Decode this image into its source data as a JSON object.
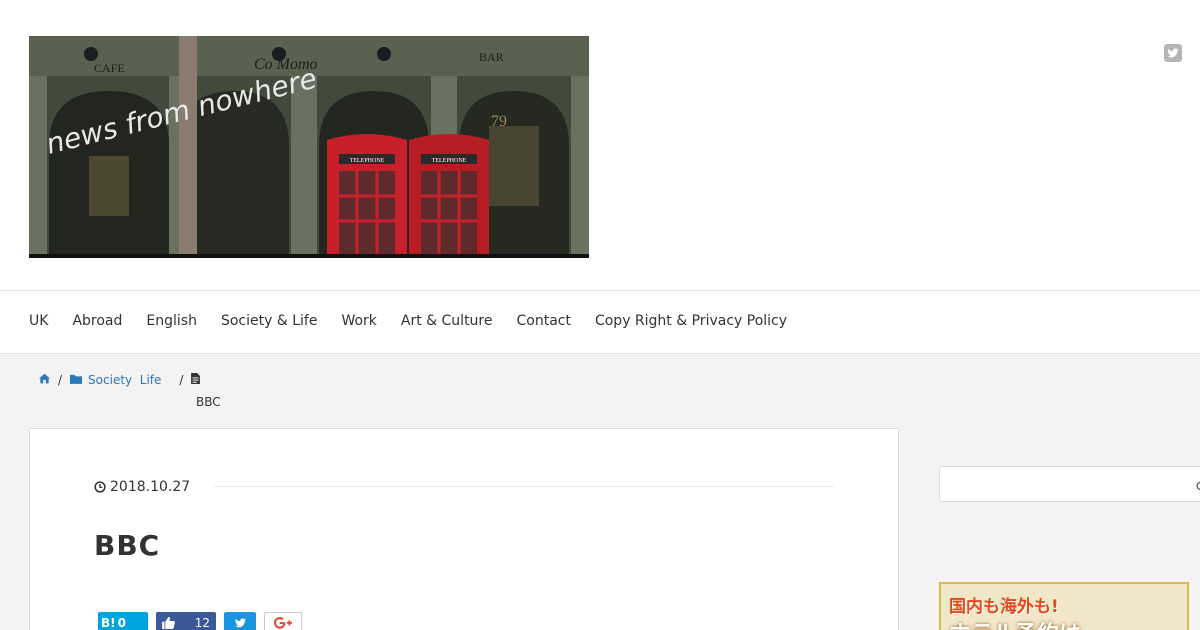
{
  "site": {
    "banner_text": "news from nowhere",
    "banner_sign_left": "CAFE",
    "banner_sign_mid": "Co Momo",
    "banner_sign_right": "BAR",
    "banner_number": "79",
    "booth_label": "TELEPHONE"
  },
  "nav": {
    "items": [
      "UK",
      "Abroad",
      "English",
      "Society & Life",
      "Work",
      "Art & Culture",
      "Contact",
      "Copy Right & Privacy Policy"
    ]
  },
  "breadcrumb": {
    "category": "Society  Life",
    "current": "BBC",
    "separator": "/"
  },
  "article": {
    "date": "2018.10.27",
    "title": "BBC"
  },
  "share": {
    "hatena_label": "B!",
    "hatena_count": "0",
    "facebook_count": "12"
  },
  "ad": {
    "line1": "国内も海外も!",
    "line2": "ホテル予約は"
  },
  "icons": {
    "twitter": "twitter-icon",
    "home": "home-icon",
    "folder": "folder-icon",
    "document": "document-icon",
    "clock": "clock-icon",
    "thumbs_up": "thumbs-up-icon",
    "google_plus": "google-plus-icon",
    "search": "search-icon"
  },
  "colors": {
    "link": "#2b78b8",
    "hatena": "#00a4de",
    "facebook": "#3b5998",
    "twitter": "#1b95e0",
    "google_plus": "#dd4b39"
  }
}
